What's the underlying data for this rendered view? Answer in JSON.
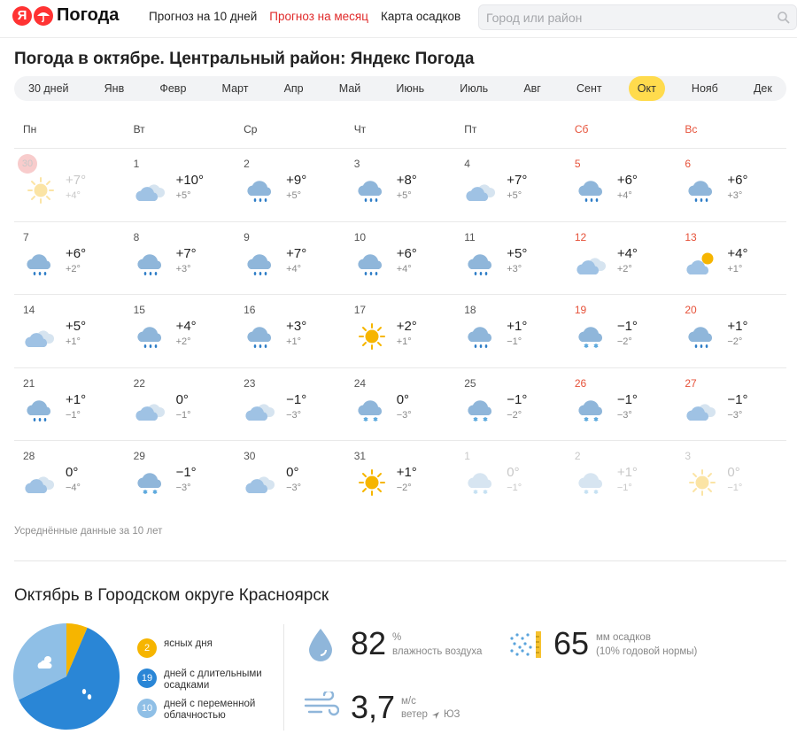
{
  "header": {
    "logo_text": "Погода",
    "logo_letter": "Я",
    "nav": [
      {
        "label": "Прогноз на 10 дней",
        "active": false
      },
      {
        "label": "Прогноз на месяц",
        "active": true
      },
      {
        "label": "Карта осадков",
        "active": false
      }
    ],
    "search_placeholder": "Город или район"
  },
  "page_title": "Погода в октябре. Центральный район: Яндекс Погода",
  "month_tabs": [
    {
      "label": "30 дней",
      "active": false
    },
    {
      "label": "Янв",
      "active": false
    },
    {
      "label": "Февр",
      "active": false
    },
    {
      "label": "Март",
      "active": false
    },
    {
      "label": "Апр",
      "active": false
    },
    {
      "label": "Май",
      "active": false
    },
    {
      "label": "Июнь",
      "active": false
    },
    {
      "label": "Июль",
      "active": false
    },
    {
      "label": "Авг",
      "active": false
    },
    {
      "label": "Сент",
      "active": false
    },
    {
      "label": "Окт",
      "active": true
    },
    {
      "label": "Нояб",
      "active": false
    },
    {
      "label": "Дек",
      "active": false
    }
  ],
  "weekdays": [
    {
      "label": "Пн",
      "weekend": false
    },
    {
      "label": "Вт",
      "weekend": false
    },
    {
      "label": "Ср",
      "weekend": false
    },
    {
      "label": "Чт",
      "weekend": false
    },
    {
      "label": "Пт",
      "weekend": false
    },
    {
      "label": "Сб",
      "weekend": true
    },
    {
      "label": "Вс",
      "weekend": true
    }
  ],
  "days": [
    {
      "num": "30",
      "max": "+7°",
      "min": "+4°",
      "icon": "sun",
      "faded": true,
      "today": true
    },
    {
      "num": "1",
      "max": "+10°",
      "min": "+5°",
      "icon": "cloudy"
    },
    {
      "num": "2",
      "max": "+9°",
      "min": "+5°",
      "icon": "rain"
    },
    {
      "num": "3",
      "max": "+8°",
      "min": "+5°",
      "icon": "rain"
    },
    {
      "num": "4",
      "max": "+7°",
      "min": "+5°",
      "icon": "cloudy"
    },
    {
      "num": "5",
      "max": "+6°",
      "min": "+4°",
      "icon": "rain"
    },
    {
      "num": "6",
      "max": "+6°",
      "min": "+3°",
      "icon": "rain"
    },
    {
      "num": "7",
      "max": "+6°",
      "min": "+2°",
      "icon": "rain"
    },
    {
      "num": "8",
      "max": "+7°",
      "min": "+3°",
      "icon": "rain"
    },
    {
      "num": "9",
      "max": "+7°",
      "min": "+4°",
      "icon": "rain"
    },
    {
      "num": "10",
      "max": "+6°",
      "min": "+4°",
      "icon": "rain"
    },
    {
      "num": "11",
      "max": "+5°",
      "min": "+3°",
      "icon": "rain"
    },
    {
      "num": "12",
      "max": "+4°",
      "min": "+2°",
      "icon": "cloudy"
    },
    {
      "num": "13",
      "max": "+4°",
      "min": "+1°",
      "icon": "partly"
    },
    {
      "num": "14",
      "max": "+5°",
      "min": "+1°",
      "icon": "cloudy"
    },
    {
      "num": "15",
      "max": "+4°",
      "min": "+2°",
      "icon": "rain"
    },
    {
      "num": "16",
      "max": "+3°",
      "min": "+1°",
      "icon": "rain"
    },
    {
      "num": "17",
      "max": "+2°",
      "min": "+1°",
      "icon": "sun"
    },
    {
      "num": "18",
      "max": "+1°",
      "min": "−1°",
      "icon": "rain"
    },
    {
      "num": "19",
      "max": "−1°",
      "min": "−2°",
      "icon": "snow"
    },
    {
      "num": "20",
      "max": "+1°",
      "min": "−2°",
      "icon": "rain"
    },
    {
      "num": "21",
      "max": "+1°",
      "min": "−1°",
      "icon": "rain"
    },
    {
      "num": "22",
      "max": "0°",
      "min": "−1°",
      "icon": "cloudy"
    },
    {
      "num": "23",
      "max": "−1°",
      "min": "−3°",
      "icon": "cloudy"
    },
    {
      "num": "24",
      "max": "0°",
      "min": "−3°",
      "icon": "snow"
    },
    {
      "num": "25",
      "max": "−1°",
      "min": "−2°",
      "icon": "snow"
    },
    {
      "num": "26",
      "max": "−1°",
      "min": "−3°",
      "icon": "snow"
    },
    {
      "num": "27",
      "max": "−1°",
      "min": "−3°",
      "icon": "cloudy"
    },
    {
      "num": "28",
      "max": "0°",
      "min": "−4°",
      "icon": "cloudy"
    },
    {
      "num": "29",
      "max": "−1°",
      "min": "−3°",
      "icon": "snow"
    },
    {
      "num": "30",
      "max": "0°",
      "min": "−3°",
      "icon": "cloudy"
    },
    {
      "num": "31",
      "max": "+1°",
      "min": "−2°",
      "icon": "sun"
    },
    {
      "num": "1",
      "max": "0°",
      "min": "−1°",
      "icon": "snow",
      "faded": true
    },
    {
      "num": "2",
      "max": "+1°",
      "min": "−1°",
      "icon": "snow",
      "faded": true
    },
    {
      "num": "3",
      "max": "0°",
      "min": "−1°",
      "icon": "sun",
      "faded": true
    }
  ],
  "avg_note": "Усреднённые данные за 10 лет",
  "summary": {
    "title": "Октябрь в Городском округе Красноярск",
    "pie": [
      {
        "value": "2",
        "label": "ясных дня",
        "color": "#f6b500"
      },
      {
        "value": "19",
        "label": "дней с длительными осадками",
        "color": "#2a86d6"
      },
      {
        "value": "10",
        "label": "дней с переменной облачностью",
        "color": "#8fbfe6"
      }
    ],
    "humidity": {
      "value": "82",
      "unit": "%",
      "label": "влажность воздуха"
    },
    "precip": {
      "value": "65",
      "unit": "мм осадков",
      "label": "(10% годовой нормы)"
    },
    "wind": {
      "value": "3,7",
      "unit": "м/с",
      "label_prefix": "ветер",
      "direction": "ЮЗ"
    }
  },
  "colors": {
    "accent": "#ffdb4d",
    "weekend": "#e65139",
    "active_link": "#e02a2a"
  }
}
